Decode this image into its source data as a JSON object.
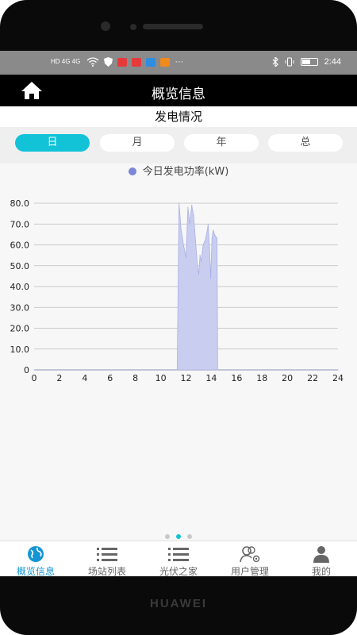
{
  "device": {
    "brand": "HUAWEI"
  },
  "status_bar": {
    "left": "HD 4G 4G",
    "time": "2:44"
  },
  "app_bar": {
    "title": "概览信息"
  },
  "section": {
    "title": "发电情况"
  },
  "tabs": [
    {
      "label": "日",
      "active": true
    },
    {
      "label": "月",
      "active": false
    },
    {
      "label": "年",
      "active": false
    },
    {
      "label": "总",
      "active": false
    }
  ],
  "chart_data": {
    "type": "area",
    "legend": "今日发电功率(kW)",
    "x_ticks": [
      0,
      2,
      4,
      6,
      8,
      10,
      12,
      14,
      16,
      18,
      20,
      22,
      24
    ],
    "y_ticks": [
      "0",
      "10.0",
      "20.0",
      "30.0",
      "40.0",
      "50.0",
      "60.0",
      "70.0",
      "80.0"
    ],
    "xlim": [
      0,
      24
    ],
    "ylim": [
      0,
      80
    ],
    "grid": true,
    "points": [
      [
        0,
        0
      ],
      [
        11.3,
        0
      ],
      [
        11.45,
        80
      ],
      [
        11.6,
        68
      ],
      [
        11.8,
        60
      ],
      [
        12.0,
        54
      ],
      [
        12.15,
        78
      ],
      [
        12.3,
        70
      ],
      [
        12.45,
        79
      ],
      [
        12.6,
        74
      ],
      [
        12.75,
        62
      ],
      [
        12.9,
        50
      ],
      [
        13.0,
        46
      ],
      [
        13.1,
        55
      ],
      [
        13.2,
        52
      ],
      [
        13.35,
        60
      ],
      [
        13.5,
        62
      ],
      [
        13.65,
        66
      ],
      [
        13.75,
        70
      ],
      [
        13.85,
        59
      ],
      [
        13.95,
        44
      ],
      [
        14.05,
        63
      ],
      [
        14.15,
        67
      ],
      [
        14.25,
        65
      ],
      [
        14.35,
        64
      ],
      [
        14.45,
        63
      ],
      [
        14.5,
        0
      ],
      [
        24,
        0
      ]
    ],
    "color": "#c9cdef",
    "line_color": "#aab1e6"
  },
  "pager": {
    "count": 3,
    "active": 1
  },
  "nav": [
    {
      "label": "概览信息",
      "icon": "globe-icon",
      "active": true
    },
    {
      "label": "场站列表",
      "icon": "list-icon",
      "active": false
    },
    {
      "label": "光伏之家",
      "icon": "list-icon",
      "active": false
    },
    {
      "label": "用户管理",
      "icon": "users-manage-icon",
      "active": false
    },
    {
      "label": "我的",
      "icon": "person-icon",
      "active": false
    }
  ],
  "colors": {
    "accent": "#12c3d8",
    "nav_active": "#1596d4"
  }
}
